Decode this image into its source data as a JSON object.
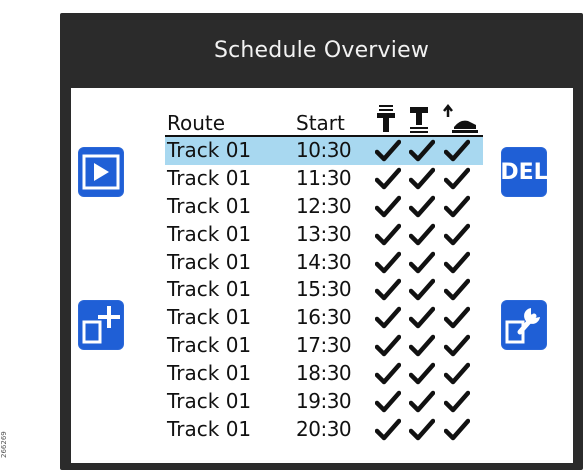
{
  "title": "Schedule Overview",
  "side_label": "266269",
  "buttons": {
    "play_label": "play",
    "add_label": "add",
    "del_label": "DEL",
    "edit_label": "edit"
  },
  "columns": {
    "route": "Route",
    "start": "Start",
    "icons": [
      "vacuum-icon",
      "mop-icon",
      "robot-lift-icon"
    ]
  },
  "rows": [
    {
      "route": "Track 01",
      "start": "10:30",
      "checks": [
        true,
        true,
        true
      ],
      "selected": true
    },
    {
      "route": "Track 01",
      "start": "11:30",
      "checks": [
        true,
        true,
        true
      ],
      "selected": false
    },
    {
      "route": "Track 01",
      "start": "12:30",
      "checks": [
        true,
        true,
        true
      ],
      "selected": false
    },
    {
      "route": "Track 01",
      "start": "13:30",
      "checks": [
        true,
        true,
        true
      ],
      "selected": false
    },
    {
      "route": "Track 01",
      "start": "14:30",
      "checks": [
        true,
        true,
        true
      ],
      "selected": false
    },
    {
      "route": "Track 01",
      "start": "15:30",
      "checks": [
        true,
        true,
        true
      ],
      "selected": false
    },
    {
      "route": "Track 01",
      "start": "16:30",
      "checks": [
        true,
        true,
        true
      ],
      "selected": false
    },
    {
      "route": "Track 01",
      "start": "17:30",
      "checks": [
        true,
        true,
        true
      ],
      "selected": false
    },
    {
      "route": "Track 01",
      "start": "18:30",
      "checks": [
        true,
        true,
        true
      ],
      "selected": false
    },
    {
      "route": "Track 01",
      "start": "19:30",
      "checks": [
        true,
        true,
        true
      ],
      "selected": false
    },
    {
      "route": "Track 01",
      "start": "20:30",
      "checks": [
        true,
        true,
        true
      ],
      "selected": false
    }
  ],
  "colors": {
    "accent": "#1f5fd6",
    "selection": "#a8d8f0",
    "frame": "#2b2b2b"
  }
}
